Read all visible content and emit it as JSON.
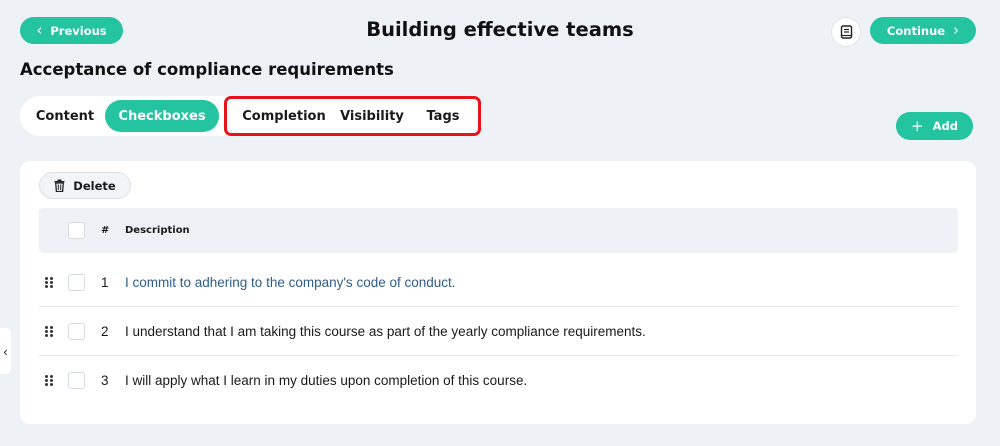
{
  "header": {
    "previous_label": "Previous",
    "title": "Building effective teams",
    "continue_label": "Continue"
  },
  "section_title": "Acceptance of compliance requirements",
  "tabs": [
    {
      "label": "Content",
      "active": false
    },
    {
      "label": "Checkboxes",
      "active": true
    },
    {
      "label": "Completion",
      "active": false
    },
    {
      "label": "Visibility",
      "active": false
    },
    {
      "label": "Tags",
      "active": false
    }
  ],
  "add_label": "Add",
  "delete_label": "Delete",
  "table": {
    "columns": [
      "#",
      "Description"
    ],
    "rows": [
      {
        "num": "1",
        "description": "I commit to adhering to the company's code of conduct."
      },
      {
        "num": "2",
        "description": "I understand that I am taking this course as part of the yearly compliance requirements."
      },
      {
        "num": "3",
        "description": "I will apply what I learn in my duties upon completion of this course."
      }
    ]
  },
  "colors": {
    "accent": "#24c4a0",
    "highlight": "#e8121c",
    "link": "#2f5d8a",
    "background": "#eef1f6"
  },
  "icons": [
    "chevron-left-icon",
    "chevron-right-icon",
    "book-icon",
    "plus-icon",
    "trash-icon",
    "drag-handle-icon",
    "collapse-chevron-icon"
  ]
}
